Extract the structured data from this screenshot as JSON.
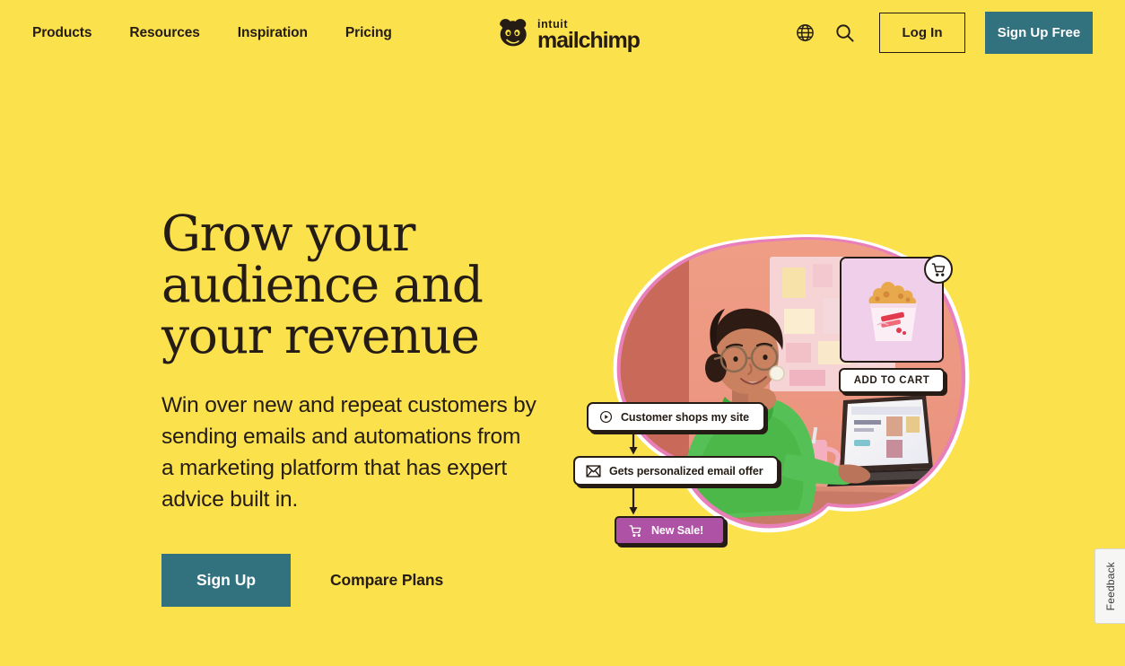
{
  "theme": {
    "background": "#FBE14C",
    "ink": "#241C15",
    "teal": "#32727F",
    "purple": "#AE52A5",
    "card_white": "#FFFFFF",
    "blob_pink": "#E87FB8",
    "blob_outline": "#FFFFFF",
    "product_bg": "#F0CFEA"
  },
  "header": {
    "nav": [
      {
        "label": "Products"
      },
      {
        "label": "Resources"
      },
      {
        "label": "Inspiration"
      },
      {
        "label": "Pricing"
      }
    ],
    "logo": {
      "mark": "freddie-chimp-icon",
      "brand_top": "intuit",
      "brand_main": "mailchimp"
    },
    "language_icon": "globe-icon",
    "search_icon": "search-icon",
    "login_label": "Log In",
    "signup_free_label": "Sign Up Free"
  },
  "hero": {
    "headline_lines": [
      "Grow your",
      "audience and",
      "your revenue"
    ],
    "subcopy": "Win over new and repeat customers by sending emails and automations from a marketing platform that has expert advice built in.",
    "primary_cta": "Sign Up",
    "secondary_cta": "Compare Plans"
  },
  "hero_art": {
    "alt": "Person in green turtleneck at desk with laptop in coral room",
    "flow_cards": [
      {
        "icon": "play-circle-icon",
        "label": "Customer shops my site"
      },
      {
        "icon": "envelope-icon",
        "label": "Gets personalized email offer"
      }
    ],
    "sale_badge": {
      "icon": "shopping-cart-icon",
      "label": "New Sale!"
    },
    "product": {
      "image_alt": "popcorn-tub",
      "cart_badge_icon": "shopping-cart-icon",
      "add_to_cart_label": "ADD TO CART"
    }
  },
  "feedback": {
    "label": "Feedback"
  }
}
